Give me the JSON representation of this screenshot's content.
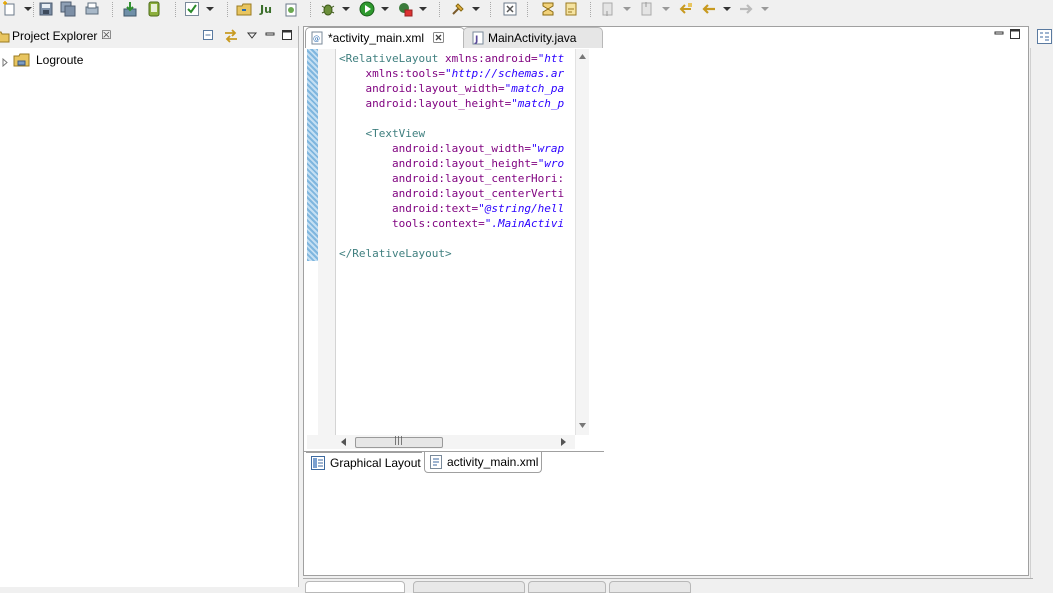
{
  "toolbar": {
    "icons": [
      "new-icon",
      "save-icon",
      "save-all-icon",
      "print-icon",
      "sdk-manager-icon",
      "avd-manager-icon",
      "lint-icon",
      "open-type-icon",
      "new-junit-icon",
      "new-project-icon",
      "debug-icon",
      "run-icon",
      "external-tools-icon",
      "search-icon",
      "open-task-icon",
      "skip-breakpoints-icon",
      "last-edit-icon",
      "annotation-icon",
      "back-icon",
      "forward-icon"
    ]
  },
  "project_explorer": {
    "title": "Project Explorer",
    "close_glyph": "☒",
    "items": [
      {
        "label": "Logroute",
        "icon": "project-folder-icon",
        "expanded": false
      }
    ]
  },
  "editor": {
    "tabs": [
      {
        "label": "*activity_main.xml",
        "active": true,
        "icon": "xml-file-icon",
        "closable": true
      },
      {
        "label": "MainActivity.java",
        "active": false,
        "icon": "java-file-icon",
        "closable": false
      }
    ],
    "code_lines": [
      [
        {
          "c": "tag",
          "t": "<RelativeLayout "
        },
        {
          "c": "attr",
          "t": "xmlns:android="
        },
        {
          "c": "val",
          "t": "\"htt"
        }
      ],
      [
        {
          "c": "attr",
          "t": "    xmlns:tools="
        },
        {
          "c": "val",
          "t": "\"http://schemas.ar"
        }
      ],
      [
        {
          "c": "attr",
          "t": "    android:layout_width="
        },
        {
          "c": "val",
          "t": "\"match_pa"
        }
      ],
      [
        {
          "c": "attr",
          "t": "    android:layout_height="
        },
        {
          "c": "val",
          "t": "\"match_p"
        }
      ],
      [],
      [
        {
          "c": "tag",
          "t": "    <TextView"
        }
      ],
      [
        {
          "c": "attr",
          "t": "        android:layout_width="
        },
        {
          "c": "val",
          "t": "\"wrap"
        }
      ],
      [
        {
          "c": "attr",
          "t": "        android:layout_height="
        },
        {
          "c": "val",
          "t": "\"wro"
        }
      ],
      [
        {
          "c": "attr",
          "t": "        android:layout_centerHori:"
        }
      ],
      [
        {
          "c": "attr",
          "t": "        android:layout_centerVerti"
        }
      ],
      [
        {
          "c": "attr",
          "t": "        android:text="
        },
        {
          "c": "val",
          "t": "\"@string/hell"
        }
      ],
      [
        {
          "c": "attr",
          "t": "        tools:context="
        },
        {
          "c": "val",
          "t": "\".MainActivi"
        }
      ],
      [],
      [
        {
          "c": "tag",
          "t": "</RelativeLayout>"
        }
      ]
    ],
    "subtabs": [
      {
        "label": "Graphical Layout",
        "active": false,
        "icon": "graphical-layout-icon"
      },
      {
        "label": "activity_main.xml",
        "active": true,
        "icon": "xml-source-icon"
      }
    ],
    "scroll_thumb_glyph": "|||"
  }
}
